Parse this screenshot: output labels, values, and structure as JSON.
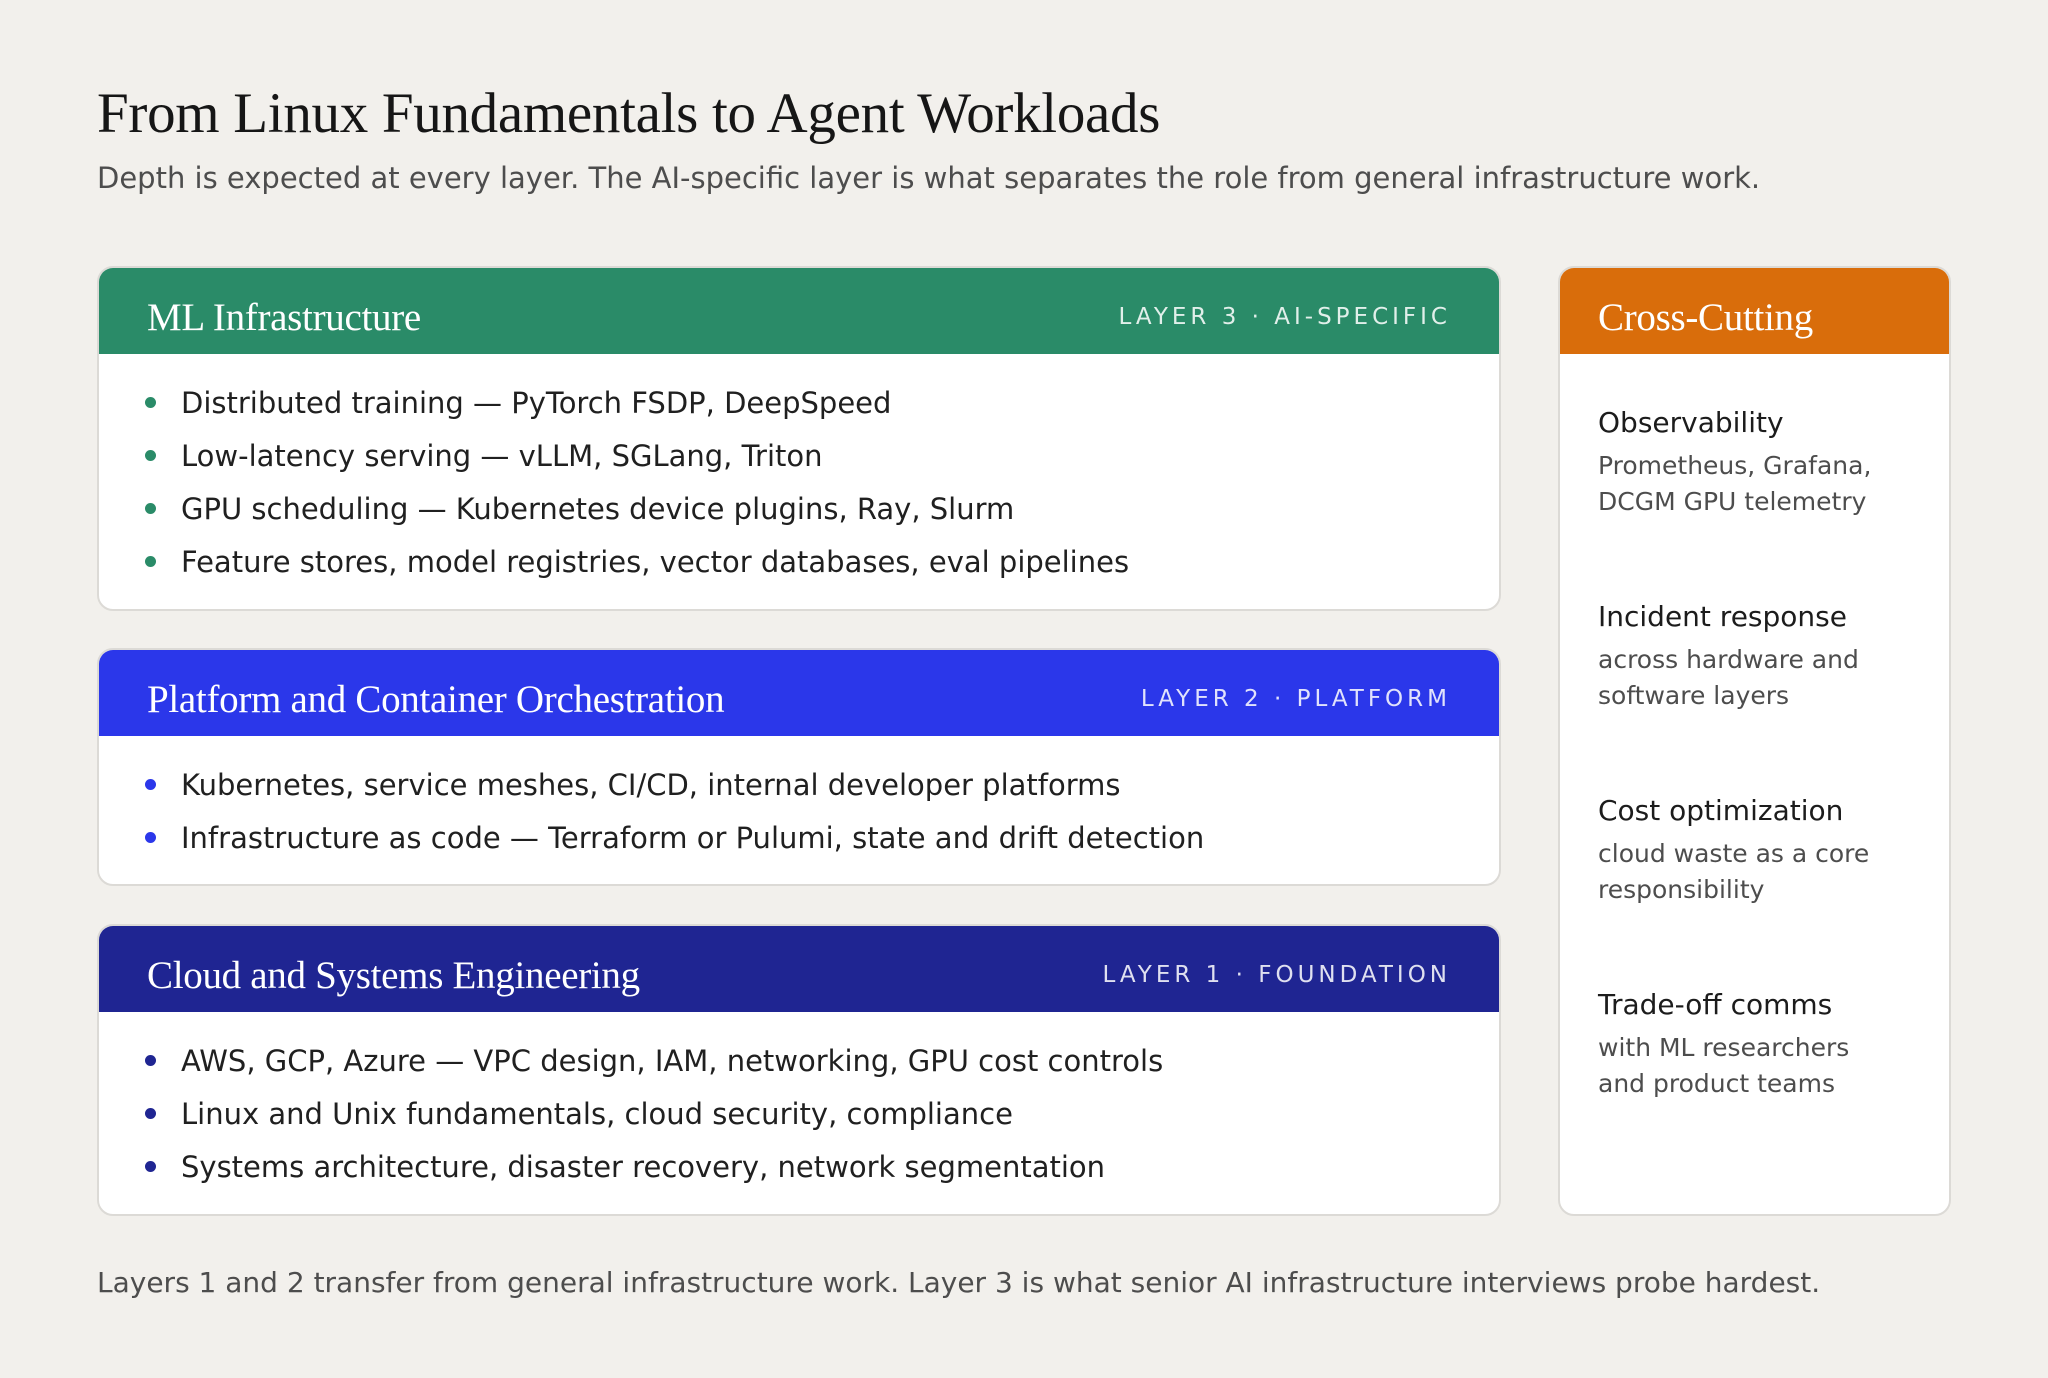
{
  "title": "From Linux Fundamentals to Agent Workloads",
  "subtitle": "Depth is expected at every layer. The AI-specific layer is what separates the role from general infrastructure work.",
  "layers": [
    {
      "title": "ML Infrastructure",
      "tag": "LAYER 3 · AI-SPECIFIC",
      "color": "#2a8b68",
      "items": [
        "Distributed training — PyTorch FSDP, DeepSpeed",
        "Low-latency serving — vLLM, SGLang, Triton",
        "GPU scheduling — Kubernetes device plugins, Ray, Slurm",
        "Feature stores, model registries, vector databases, eval pipelines"
      ]
    },
    {
      "title": "Platform and Container Orchestration",
      "tag": "LAYER 2 · PLATFORM",
      "color": "#2b37ea",
      "items": [
        "Kubernetes, service meshes, CI/CD, internal developer platforms",
        "Infrastructure as code — Terraform or Pulumi, state and drift detection"
      ]
    },
    {
      "title": "Cloud and Systems Engineering",
      "tag": "LAYER 1 · FOUNDATION",
      "color": "#1f2592",
      "items": [
        "AWS, GCP, Azure — VPC design, IAM, networking, GPU cost controls",
        "Linux and Unix fundamentals, cloud security, compliance",
        "Systems architecture, disaster recovery, network segmentation"
      ]
    }
  ],
  "cross_cutting": {
    "title": "Cross-Cutting",
    "color": "#d96d0b",
    "items": [
      {
        "title": "Observability",
        "line1": "Prometheus, Grafana,",
        "line2": "DCGM GPU telemetry"
      },
      {
        "title": "Incident response",
        "line1": "across hardware and",
        "line2": "software layers"
      },
      {
        "title": "Cost optimization",
        "line1": "cloud waste as a core",
        "line2": "responsibility"
      },
      {
        "title": "Trade-off comms",
        "line1": "with ML researchers",
        "line2": "and product teams"
      }
    ]
  },
  "footer": "Layers 1 and 2 transfer from general infrastructure work. Layer 3 is what senior AI infrastructure interviews probe hardest."
}
